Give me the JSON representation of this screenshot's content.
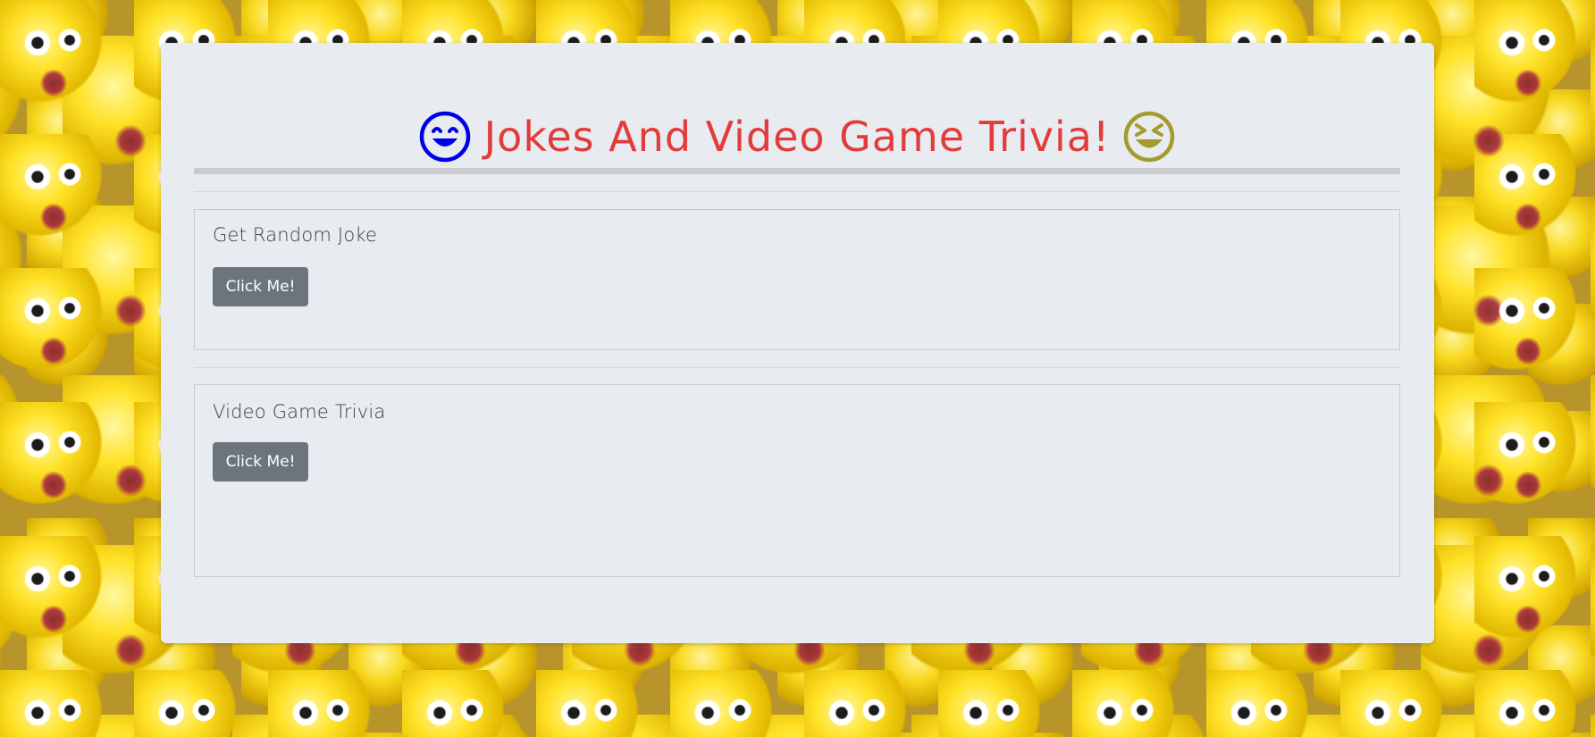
{
  "header": {
    "title": "Jokes And Video Game Trivia!",
    "left_icon": "smiling-face-icon",
    "right_icon": "grinning-squinting-face-icon",
    "title_color": "#e23b3b",
    "left_icon_color": "#0000e6",
    "right_icon_color": "#a49a2e"
  },
  "sections": {
    "joke": {
      "title": "Get Random Joke",
      "button_label": "Click Me!"
    },
    "trivia": {
      "title": "Video Game Trivia",
      "button_label": "Click Me!"
    }
  },
  "colors": {
    "card_bg": "#e8ebef",
    "button_bg": "#6c757d"
  }
}
